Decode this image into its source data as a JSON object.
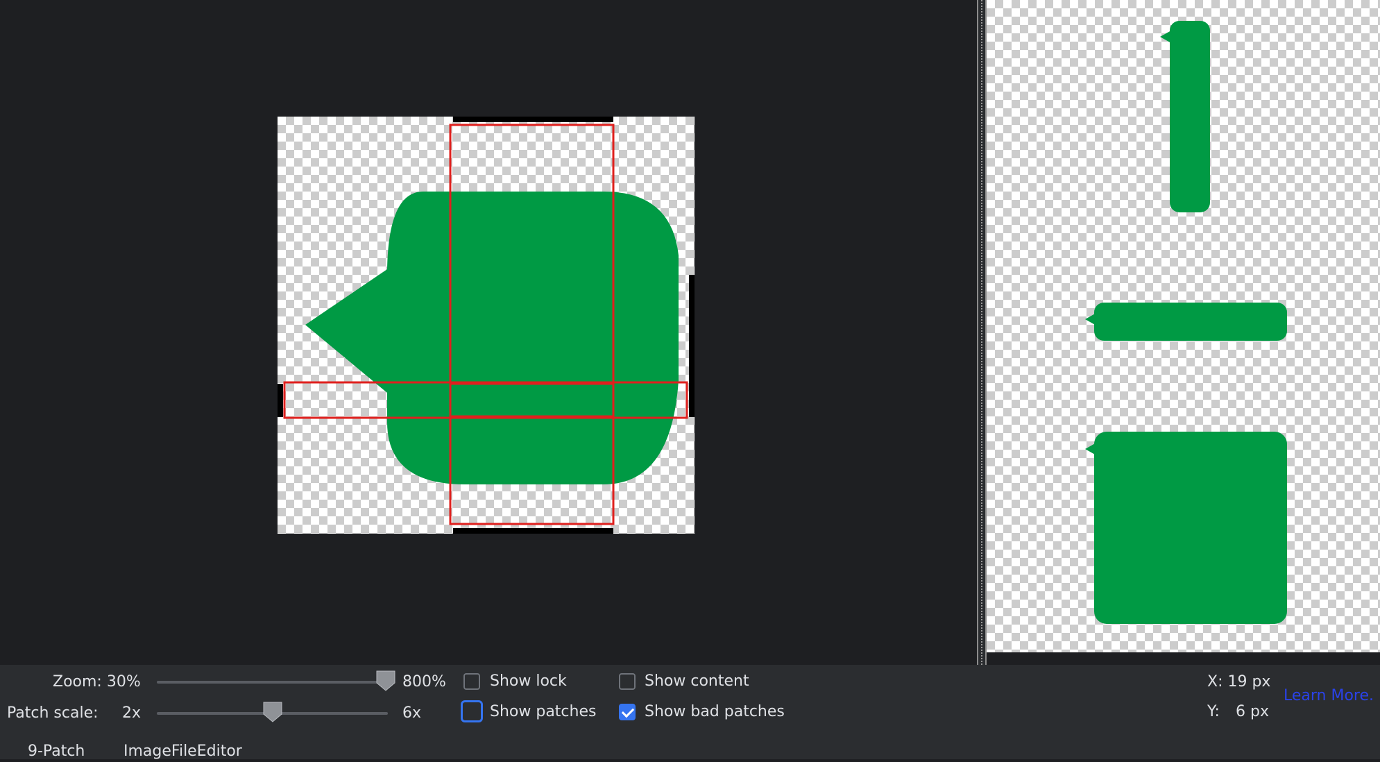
{
  "colors": {
    "background": "#1e1f22",
    "panel": "#2b2d30",
    "patch_fill": "#009a44",
    "patch_outline": "#e0201e",
    "accent": "#3574f0",
    "link": "#2a42e8"
  },
  "zoom": {
    "label": "Zoom: 30%",
    "max_label": "800%",
    "value_percent": 100
  },
  "patch_scale": {
    "label": "Patch scale:",
    "min_label": "2x",
    "max_label": "6x",
    "value_fraction": 0.5
  },
  "checkboxes": {
    "show_lock": {
      "label": "Show lock",
      "checked": false
    },
    "show_content": {
      "label": "Show content",
      "checked": false
    },
    "show_patches": {
      "label": "Show patches",
      "checked": false
    },
    "show_bad_patches": {
      "label": "Show bad patches",
      "checked": true
    }
  },
  "coords": {
    "x": "X: 19 px",
    "y_label": "Y:",
    "y_value": "6 px"
  },
  "learn_more": "Learn More.",
  "tabs": [
    "9-Patch",
    "ImageFileEditor"
  ]
}
